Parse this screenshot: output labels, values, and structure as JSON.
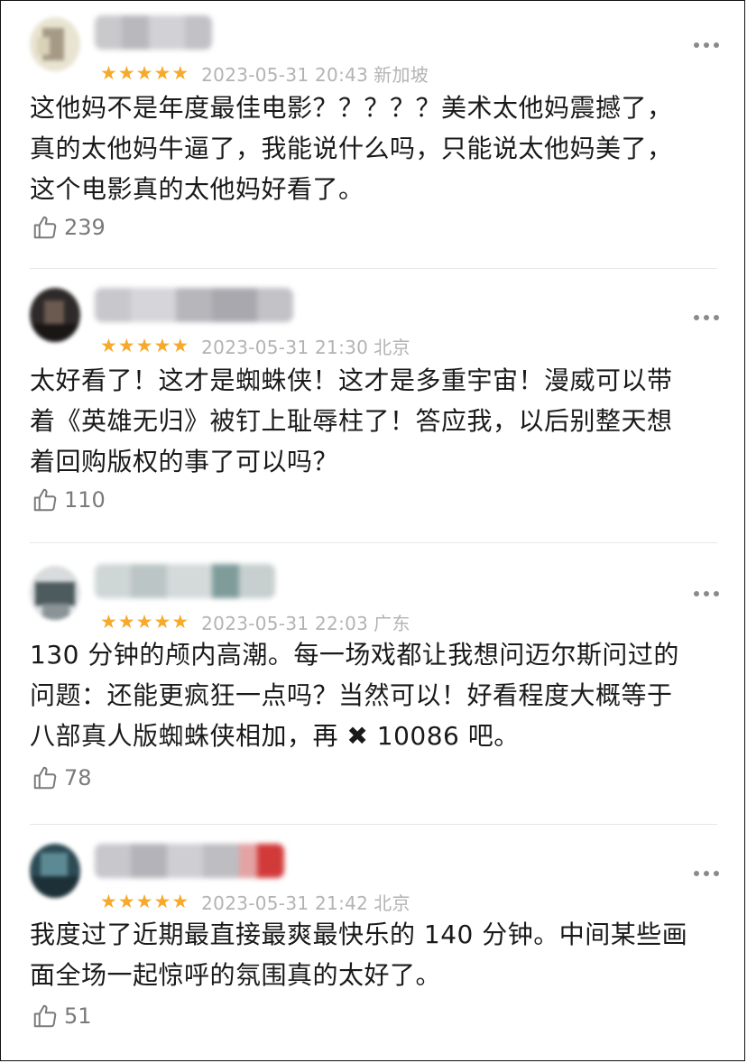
{
  "reviews": [
    {
      "stars": "★★★★★",
      "date": "2023-05-31 20:43",
      "location": "新加坡",
      "text": "这他妈不是年度最佳电影？？？？？美术太他妈震撼了，\n真的太他妈牛逼了，我能说什么吗，只能说太他妈美了，\n这个电影真的太他妈好看了。",
      "likes": "239"
    },
    {
      "stars": "★★★★★",
      "date": "2023-05-31 21:30",
      "location": "北京",
      "text": "太好看了！这才是蜘蛛侠！这才是多重宇宙！漫威可以带\n着《英雄无归》被钉上耻辱柱了！答应我，以后别整天想\n着回购版权的事了可以吗？",
      "likes": "110"
    },
    {
      "stars": "★★★★★",
      "date": "2023-05-31 22:03",
      "location": "广东",
      "text": "130 分钟的颅内高潮。每一场戏都让我想问迈尔斯问过的\n问题：还能更疯狂一点吗？当然可以！好看程度大概等于\n八部真人版蜘蛛侠相加，再 ✖ 10086 吧。",
      "likes": "78"
    },
    {
      "stars": "★★★★★",
      "date": "2023-05-31 21:42",
      "location": "北京",
      "text": "我度过了近期最直接最爽最快乐的 140 分钟。中间某些画\n面全场一起惊呼的氛围真的太好了。",
      "likes": "51"
    }
  ],
  "colors": {
    "star": "#f7a92a",
    "meta": "#b3b3b3",
    "text": "#1a1a1a",
    "likes": "#7a7a7a"
  },
  "icons": {
    "like": "thumbs-up-icon",
    "more": "more-dots-icon"
  }
}
